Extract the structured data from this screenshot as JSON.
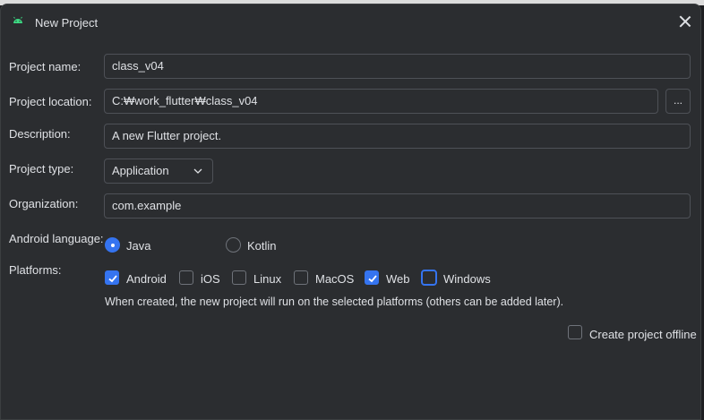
{
  "dialog": {
    "title": "New Project",
    "title_icon": "android-icon",
    "close_icon": "close-icon"
  },
  "form": {
    "project_name": {
      "label": "Project name:",
      "value": "class_v04"
    },
    "project_location": {
      "label": "Project location:",
      "value": "C:₩work_flutter₩class_v04",
      "browse_label": "..."
    },
    "description": {
      "label": "Description:",
      "value": "A new Flutter project."
    },
    "project_type": {
      "label": "Project type:",
      "selected": "Application"
    },
    "organization": {
      "label": "Organization:",
      "value": "com.example"
    },
    "android_language": {
      "label": "Android language:",
      "options": [
        {
          "label": "Java",
          "selected": true
        },
        {
          "label": "Kotlin",
          "selected": false
        }
      ]
    },
    "platforms": {
      "label": "Platforms:",
      "items": [
        {
          "label": "Android",
          "checked": true
        },
        {
          "label": "iOS",
          "checked": false
        },
        {
          "label": "Linux",
          "checked": false
        },
        {
          "label": "MacOS",
          "checked": false
        },
        {
          "label": "Web",
          "checked": true
        },
        {
          "label": "Windows",
          "checked": false,
          "focused": true
        }
      ],
      "hint": "When created, the new project will run on the selected platforms (others can be added later)."
    },
    "offline": {
      "label": "Create project offline",
      "checked": false
    }
  },
  "colors": {
    "background": "#2b2d30",
    "accent": "#3574f0",
    "border": "#4e5157",
    "text": "#dfe1e5"
  }
}
